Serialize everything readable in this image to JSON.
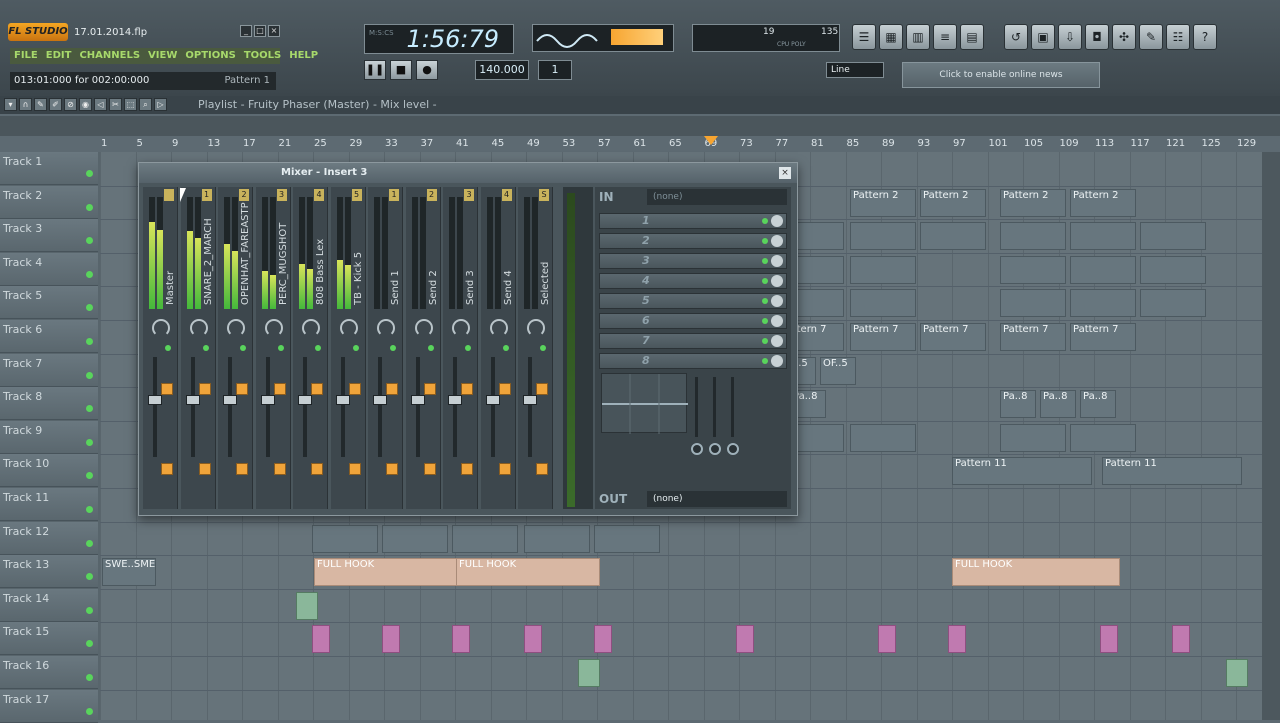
{
  "app": {
    "logo": "FL STUDIO",
    "filename": "17.01.2014.flp"
  },
  "menu": [
    "FILE",
    "EDIT",
    "CHANNELS",
    "VIEW",
    "OPTIONS",
    "TOOLS",
    "HELP"
  ],
  "song_position": {
    "text": "013:01:000 for 002:00:000",
    "pattern": "Pattern 1"
  },
  "time_display": {
    "value": "1:56:79",
    "labels": "M:S:CS"
  },
  "tempo": "140.000",
  "pattern_number": "1",
  "cpu": {
    "a": "19",
    "b": "135",
    "labels": "CPU POLY"
  },
  "transport": {
    "play": "▶",
    "pause": "❚❚",
    "stop": "■",
    "record": "●"
  },
  "record_mode": "Line",
  "news": "Click to enable online news",
  "playlist": {
    "title": "Playlist - Fruity Phaser (Master) - Mix level -"
  },
  "ruler_numbers": [
    "1",
    "5",
    "9",
    "13",
    "17",
    "21",
    "25",
    "29",
    "33",
    "37",
    "41",
    "45",
    "49",
    "53",
    "57",
    "61",
    "65",
    "69",
    "73",
    "77",
    "81",
    "85",
    "89",
    "93",
    "97",
    "101",
    "105",
    "109",
    "113",
    "117",
    "121",
    "125",
    "129"
  ],
  "tracks": [
    "Track 1",
    "Track 2",
    "Track 3",
    "Track 4",
    "Track 5",
    "Track 6",
    "Track 7",
    "Track 8",
    "Track 9",
    "Track 10",
    "Track 11",
    "Track 12",
    "Track 13",
    "Track 14",
    "Track 15",
    "Track 16",
    "Track 17"
  ],
  "clips": {
    "pattern2": "Pattern 2",
    "pattern7": "Pattern 7",
    "pattern11": "Pattern 11",
    "full_hook": "FULL HOOK",
    "swe": "SWE..SME",
    "pattern8": "Pa..8",
    "of5": "OF..5"
  },
  "mixer": {
    "title": "Mixer - Insert 3",
    "in_label": "IN",
    "in_value": "(none)",
    "out_label": "OUT",
    "out_value": "(none)",
    "strips": [
      {
        "name": "Master",
        "num": ""
      },
      {
        "name": "SNARE_2_MARCH",
        "num": "1"
      },
      {
        "name": "OPENHAT_FAREASTP",
        "num": "2"
      },
      {
        "name": "PERC_MUGSHOT",
        "num": "3"
      },
      {
        "name": "808 Bass Lex",
        "num": "4"
      },
      {
        "name": "TB - Kick 5",
        "num": "5"
      },
      {
        "name": "Send 1",
        "num": "1"
      },
      {
        "name": "Send 2",
        "num": "2"
      },
      {
        "name": "Send 3",
        "num": "3"
      },
      {
        "name": "Send 4",
        "num": "4"
      },
      {
        "name": "Selected",
        "num": "S"
      }
    ],
    "slots": [
      "1",
      "2",
      "3",
      "4",
      "5",
      "6",
      "7",
      "8"
    ]
  }
}
